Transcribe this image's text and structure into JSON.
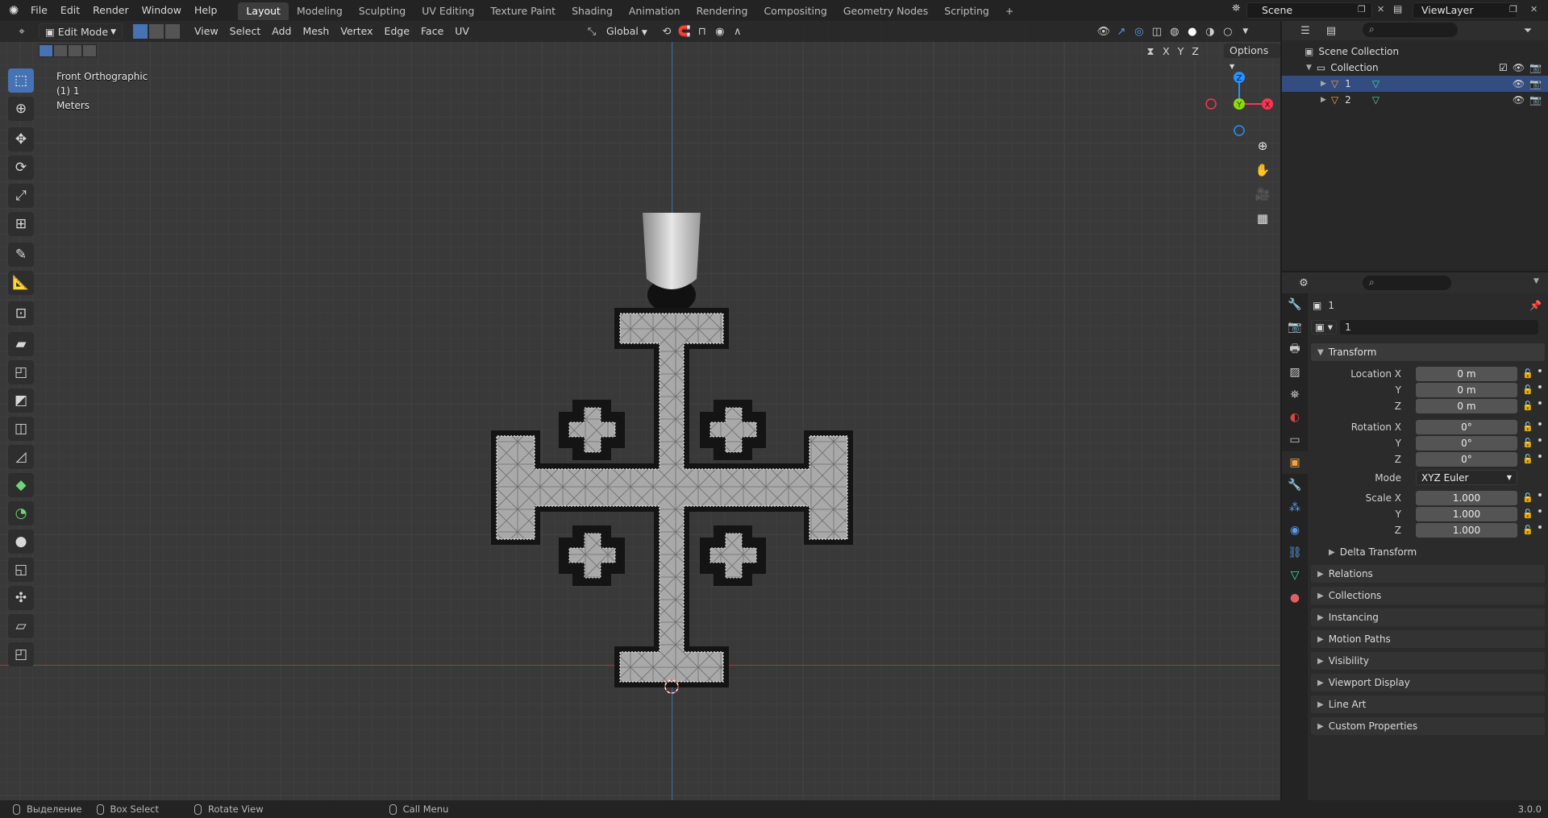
{
  "topbar": {
    "menus": [
      "File",
      "Edit",
      "Render",
      "Window",
      "Help"
    ],
    "workspaces": [
      "Layout",
      "Modeling",
      "Sculpting",
      "UV Editing",
      "Texture Paint",
      "Shading",
      "Animation",
      "Rendering",
      "Compositing",
      "Geometry Nodes",
      "Scripting"
    ],
    "active_workspace": "Layout",
    "add_tab": "+",
    "scene": "Scene",
    "view_layer": "ViewLayer"
  },
  "viewport": {
    "mode": "Edit Mode",
    "menus": [
      "View",
      "Select",
      "Add",
      "Mesh",
      "Vertex",
      "Edge",
      "Face",
      "UV"
    ],
    "orientation": "Global",
    "axes": [
      "X",
      "Y",
      "Z"
    ],
    "options": "Options",
    "overlay": {
      "view_name": "Front Orthographic",
      "object_info": "(1) 1",
      "units": "Meters"
    },
    "gizmo": {
      "z": "Z",
      "y": "Y",
      "x": "X"
    }
  },
  "outliner": {
    "root": "Scene Collection",
    "collection": "Collection",
    "objects": [
      {
        "name": "1",
        "selected": true
      },
      {
        "name": "2",
        "selected": false
      }
    ]
  },
  "properties": {
    "object_name": "1",
    "mesh_name": "1",
    "transform": {
      "title": "Transform",
      "location_label": "Location X",
      "rotation_label": "Rotation X",
      "scale_label": "Scale X",
      "y_label": "Y",
      "z_label": "Z",
      "location": [
        "0 m",
        "0 m",
        "0 m"
      ],
      "rotation": [
        "0°",
        "0°",
        "0°"
      ],
      "mode_label": "Mode",
      "mode": "XYZ Euler",
      "scale": [
        "1.000",
        "1.000",
        "1.000"
      ],
      "delta": "Delta Transform"
    },
    "panels": [
      "Relations",
      "Collections",
      "Instancing",
      "Motion Paths",
      "Visibility",
      "Viewport Display",
      "Line Art",
      "Custom Properties"
    ]
  },
  "statusbar": {
    "select": "Выделение",
    "box_select": "Box Select",
    "rotate_view": "Rotate View",
    "call_menu": "Call Menu",
    "version": "3.0.0"
  },
  "colors": {
    "accent": "#4772b3",
    "x_axis": "#ff3352",
    "y_axis": "#8bdc00",
    "z_axis": "#2890ff",
    "mesh_fill": "#a8a8a8"
  },
  "icons": {
    "blender": "blender-logo-icon",
    "search": "search-icon",
    "filter": "filter-icon",
    "eye": "eye-icon",
    "camera": "camera-icon"
  }
}
